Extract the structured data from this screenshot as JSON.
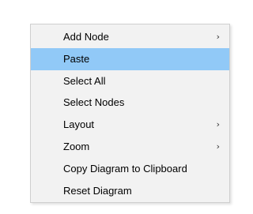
{
  "context_menu": {
    "items": [
      {
        "label": "Add Node",
        "submenu_arrow": "›",
        "highlighted": false
      },
      {
        "label": "Paste",
        "highlighted": true
      },
      {
        "label": "Select All",
        "highlighted": false
      },
      {
        "label": "Select Nodes",
        "highlighted": false
      },
      {
        "label": "Layout",
        "submenu_arrow": "›",
        "highlighted": false
      },
      {
        "label": "Zoom",
        "submenu_arrow": "›",
        "highlighted": false
      },
      {
        "label": "Copy Diagram to Clipboard",
        "highlighted": false
      },
      {
        "label": "Reset Diagram",
        "highlighted": false
      }
    ],
    "highlight_color": "#91c9f7",
    "background_color": "#f2f2f2",
    "border_color": "#cfcfcf"
  }
}
